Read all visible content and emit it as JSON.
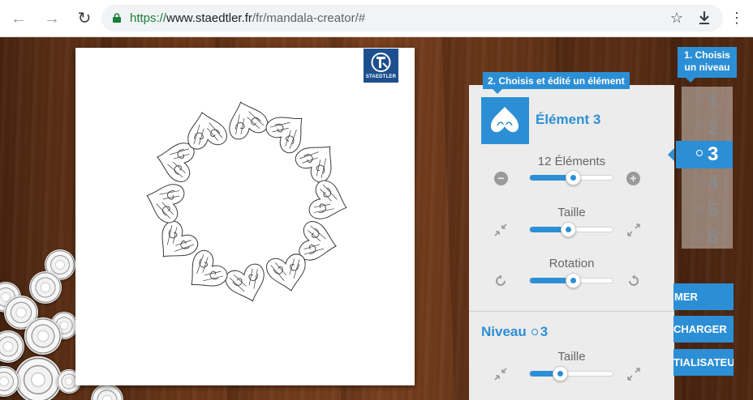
{
  "browser": {
    "url_scheme": "https://",
    "url_host": "www.staedtler.fr",
    "url_path": "/fr/mandala-creator/#"
  },
  "logo": {
    "text": "STAEDTLER"
  },
  "panel": {
    "step2_label": "2. Choisis et édité un élément",
    "element_title": "Élément 3",
    "count_label": "12 Éléments",
    "count_value": 0.53,
    "size_label": "Taille",
    "size_value": 0.47,
    "rotation_label": "Rotation",
    "rotation_value": 0.53,
    "level_title": "Niveau",
    "level_number": "3",
    "level_size_label": "Taille",
    "level_size_value": 0.37
  },
  "levels": {
    "step1_label": "1. Choisis un niveau",
    "items": [
      "1",
      "2",
      "3",
      "4",
      "5",
      "6"
    ],
    "active_index": 2
  },
  "actions": {
    "print_label": "MER",
    "download_label": "CHARGER",
    "reset_label": "TIALISATEUR"
  },
  "colors": {
    "accent": "#2c8fd6",
    "brand": "#1d4f8e",
    "panel_bg": "#ececec"
  },
  "icons": {
    "back": "arrow-left-icon",
    "forward": "arrow-right-icon",
    "reload": "reload-icon",
    "lock": "lock-icon",
    "star": "star-icon",
    "download": "download-icon",
    "menu": "kebab-menu-icon",
    "decrease": "minus-circle-icon",
    "increase": "plus-circle-icon",
    "shrink": "shrink-arrows-icon",
    "expand": "expand-arrows-icon",
    "rotate_left": "rotate-left-icon",
    "rotate_right": "rotate-right-icon"
  }
}
